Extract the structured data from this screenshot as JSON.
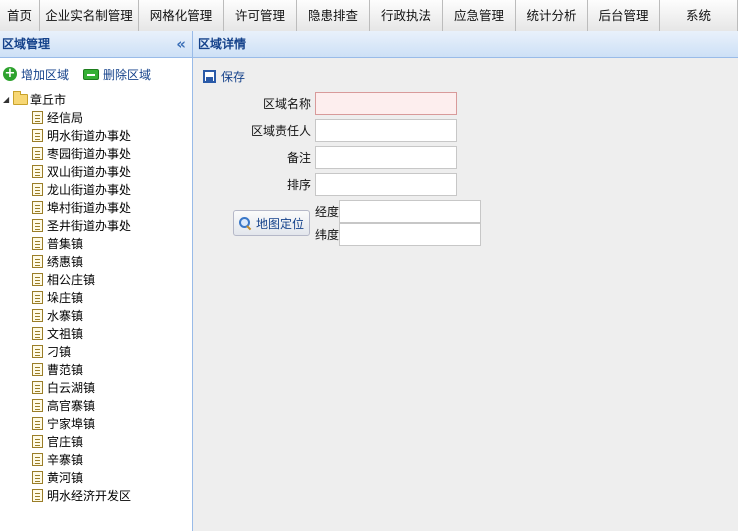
{
  "nav": {
    "tabs": [
      {
        "label": "首页"
      },
      {
        "label": "企业实名制管理"
      },
      {
        "label": "网格化管理"
      },
      {
        "label": "许可管理"
      },
      {
        "label": "隐患排查"
      },
      {
        "label": "行政执法"
      },
      {
        "label": "应急管理"
      },
      {
        "label": "统计分析"
      },
      {
        "label": "后台管理"
      },
      {
        "label": "系统"
      }
    ]
  },
  "left_panel": {
    "title": "区域管理",
    "collapse_glyph": "«",
    "toolbar": {
      "add_label": "增加区域",
      "delete_label": "删除区域"
    },
    "tree": {
      "root_label": "章丘市",
      "children": [
        "经信局",
        "明水街道办事处",
        "枣园街道办事处",
        "双山街道办事处",
        "龙山街道办事处",
        "埠村街道办事处",
        "圣井街道办事处",
        "普集镇",
        "绣惠镇",
        "相公庄镇",
        "垛庄镇",
        "水寨镇",
        "文祖镇",
        "刁镇",
        "曹范镇",
        "白云湖镇",
        "高官寨镇",
        "宁家埠镇",
        "官庄镇",
        "辛寨镇",
        "黄河镇",
        "明水经济开发区"
      ]
    }
  },
  "right_panel": {
    "title": "区域详情",
    "save_label": "保存",
    "fields": {
      "name_label": "区域名称",
      "name_value": "",
      "owner_label": "区域责任人",
      "owner_value": "",
      "remark_label": "备注",
      "remark_value": "",
      "order_label": "排序",
      "order_value": ""
    },
    "map_button_label": "地图定位",
    "longitude_label": "经度",
    "longitude_value": "",
    "latitude_label": "纬度",
    "latitude_value": ""
  }
}
